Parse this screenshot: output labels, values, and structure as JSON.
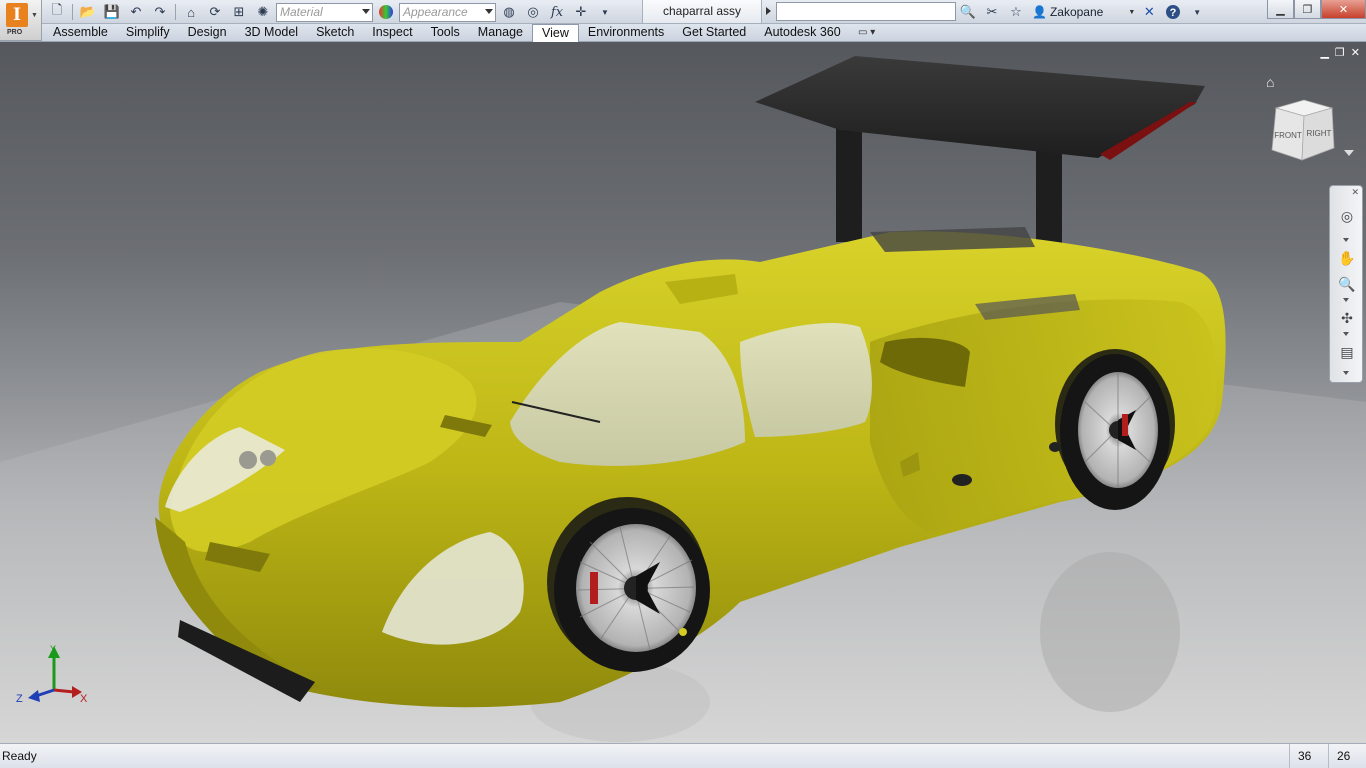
{
  "app": {
    "logo_letter": "I",
    "edition": "PRO"
  },
  "document": {
    "title": "chaparral assy"
  },
  "quick_access": {
    "material_placeholder": "Material",
    "appearance_placeholder": "Appearance",
    "fx_label": "fx",
    "search_value": "",
    "user_name": "Zakopane"
  },
  "icons": {
    "new": "new-file-icon",
    "open": "open-folder-icon",
    "save": "save-icon",
    "undo": "undo-icon",
    "redo": "redo-icon",
    "home": "home-icon",
    "search": "binoculars-icon",
    "help": "help-icon"
  },
  "ribbon": {
    "tabs": [
      "Assemble",
      "Simplify",
      "Design",
      "3D Model",
      "Sketch",
      "Inspect",
      "Tools",
      "Manage",
      "View",
      "Environments",
      "Get Started",
      "Autodesk 360"
    ],
    "active_tab": "View"
  },
  "viewcube": {
    "front": "FRONT",
    "right": "RIGHT"
  },
  "triad": {
    "x": "X",
    "y": "Y",
    "z": "Z"
  },
  "status": {
    "text": "Ready",
    "count1": "36",
    "count2": "26"
  },
  "colors": {
    "car_body": "#c9c21a",
    "accent": "#e8821e"
  }
}
